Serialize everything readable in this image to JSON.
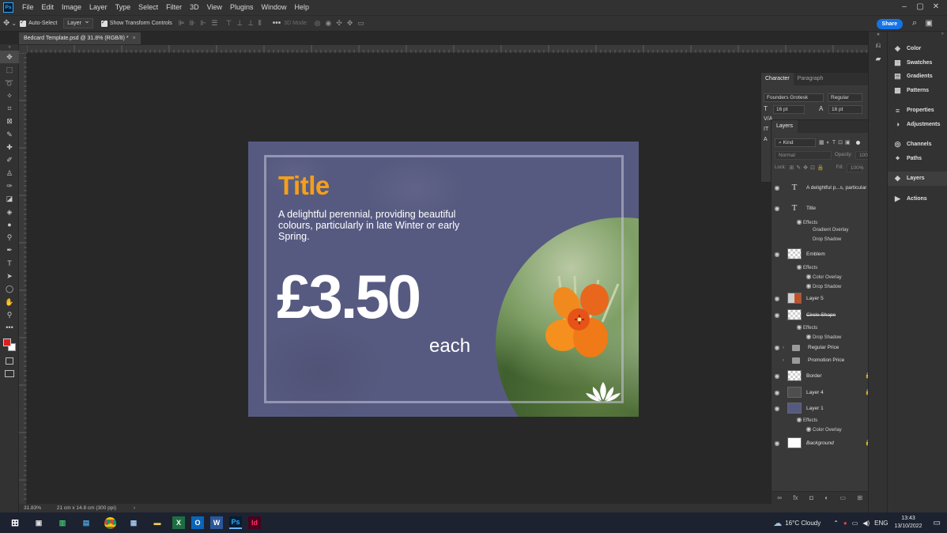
{
  "window": {
    "app_logo": "Ps",
    "doc_tab": "Bedcard Template.psd @ 31.8% (RGB/8) *"
  },
  "menu": [
    "File",
    "Edit",
    "Image",
    "Layer",
    "Type",
    "Select",
    "Filter",
    "3D",
    "View",
    "Plugins",
    "Window",
    "Help"
  ],
  "options": {
    "auto_select": "Auto-Select",
    "layer_select": "Layer",
    "show_transform": "Show Transform Controls",
    "mode_3d": "3D Mode:",
    "share": "Share"
  },
  "document": {
    "title": "Title",
    "description": "A delightful perennial, providing beautiful colours, particularly in late Winter or early Spring.",
    "price": "£3.50",
    "unit": "each",
    "colors": {
      "background": "#575a80",
      "title": "#f5a01a"
    }
  },
  "character": {
    "tabs": [
      "Character",
      "Paragraph"
    ],
    "font_family": "Founders Grotesk",
    "font_style": "Regular",
    "font_size": "16 pt",
    "leading": "16 pt"
  },
  "layers": {
    "tab": "Layers",
    "filter": "Kind",
    "blend_mode": "Normal",
    "opacity_label": "Opacity:",
    "opacity_value": "100%",
    "lock_label": "Lock:",
    "fill_label": "Fill:",
    "fill_value": "100%",
    "items": [
      {
        "name": "A delightful p...s, particular",
        "type": "text"
      },
      {
        "name": "Title",
        "type": "text",
        "fx": true
      },
      {
        "name": "Emblem",
        "type": "raster",
        "fx": true
      },
      {
        "name": "Layer 5",
        "type": "raster"
      },
      {
        "name": "Circle Shape",
        "type": "raster",
        "fx": true
      },
      {
        "name": "Regular Price",
        "type": "group"
      },
      {
        "name": "Promotion Price",
        "type": "group"
      },
      {
        "name": "Border",
        "type": "raster"
      },
      {
        "name": "Layer 4",
        "type": "raster"
      },
      {
        "name": "Layer 1",
        "type": "raster",
        "fx": true
      },
      {
        "name": "Background",
        "type": "raster"
      }
    ],
    "effects": {
      "effects_label": "Effects",
      "gradient_overlay": "Gradient Overlay",
      "drop_shadow": "Drop Shadow",
      "color_overlay": "Color Overlay"
    }
  },
  "dock": [
    "Color",
    "Swatches",
    "Gradients",
    "Patterns",
    "Properties",
    "Adjustments",
    "Channels",
    "Paths",
    "Layers",
    "Actions"
  ],
  "status": {
    "zoom": "31.83%",
    "doc_size": "21 cm x 14.8 cm (300 ppi)"
  },
  "taskbar": {
    "weather": "16°C  Cloudy",
    "lang": "ENG",
    "time": "13:43",
    "date": "13/10/2022"
  }
}
